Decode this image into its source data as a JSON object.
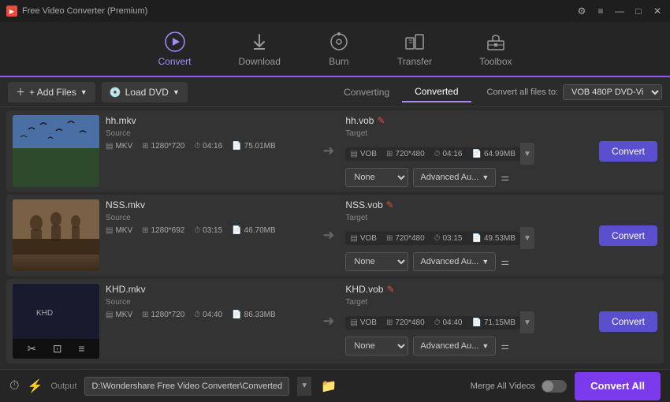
{
  "app": {
    "title": "Free Video Converter (Premium)",
    "title_icon": "▶"
  },
  "titlebar": {
    "right_icons": [
      "⚙",
      "≡",
      "—",
      "□",
      "✕"
    ]
  },
  "nav": {
    "items": [
      {
        "id": "convert",
        "label": "Convert",
        "active": true,
        "icon": "convert"
      },
      {
        "id": "download",
        "label": "Download",
        "active": false,
        "icon": "download"
      },
      {
        "id": "burn",
        "label": "Burn",
        "active": false,
        "icon": "burn"
      },
      {
        "id": "transfer",
        "label": "Transfer",
        "active": false,
        "icon": "transfer"
      },
      {
        "id": "toolbox",
        "label": "Toolbox",
        "active": false,
        "icon": "toolbox"
      }
    ]
  },
  "toolbar": {
    "add_files_label": "+ Add Files",
    "load_dvd_label": "Load DVD",
    "tab_converting": "Converting",
    "tab_converted": "Converted",
    "convert_all_to_label": "Convert all files to:",
    "format_select": "VOB 480P DVD-Vi"
  },
  "files": [
    {
      "id": "file1",
      "source_name": "hh.mkv",
      "target_name": "hh.vob",
      "thumb_type": "birds",
      "source": {
        "format": "MKV",
        "resolution": "1280*720",
        "duration": "04:16",
        "size": "75.01MB"
      },
      "target": {
        "format": "VOB",
        "resolution": "720*480",
        "duration": "04:16",
        "size": "64.99MB"
      },
      "effect": "None",
      "advanced": "Advanced Au..."
    },
    {
      "id": "file2",
      "source_name": "NSS.mkv",
      "target_name": "NSS.vob",
      "thumb_type": "people",
      "source": {
        "format": "MKV",
        "resolution": "1280*692",
        "duration": "03:15",
        "size": "46.70MB"
      },
      "target": {
        "format": "VOB",
        "resolution": "720*480",
        "duration": "03:15",
        "size": "49.53MB"
      },
      "effect": "None",
      "advanced": "Advanced Au..."
    },
    {
      "id": "file3",
      "source_name": "KHD.mkv",
      "target_name": "KHD.vob",
      "thumb_type": "dark",
      "source": {
        "format": "MKV",
        "resolution": "1280*720",
        "duration": "04:40",
        "size": "86.33MB"
      },
      "target": {
        "format": "VOB",
        "resolution": "720*480",
        "duration": "04:40",
        "size": "71.15MB"
      },
      "effect": "None",
      "advanced": "Advanced Au..."
    }
  ],
  "bottom": {
    "output_label": "Output",
    "output_path": "D:\\Wondershare Free Video Converter\\Converted",
    "merge_label": "Merge All Videos",
    "convert_all_label": "Convert All"
  }
}
